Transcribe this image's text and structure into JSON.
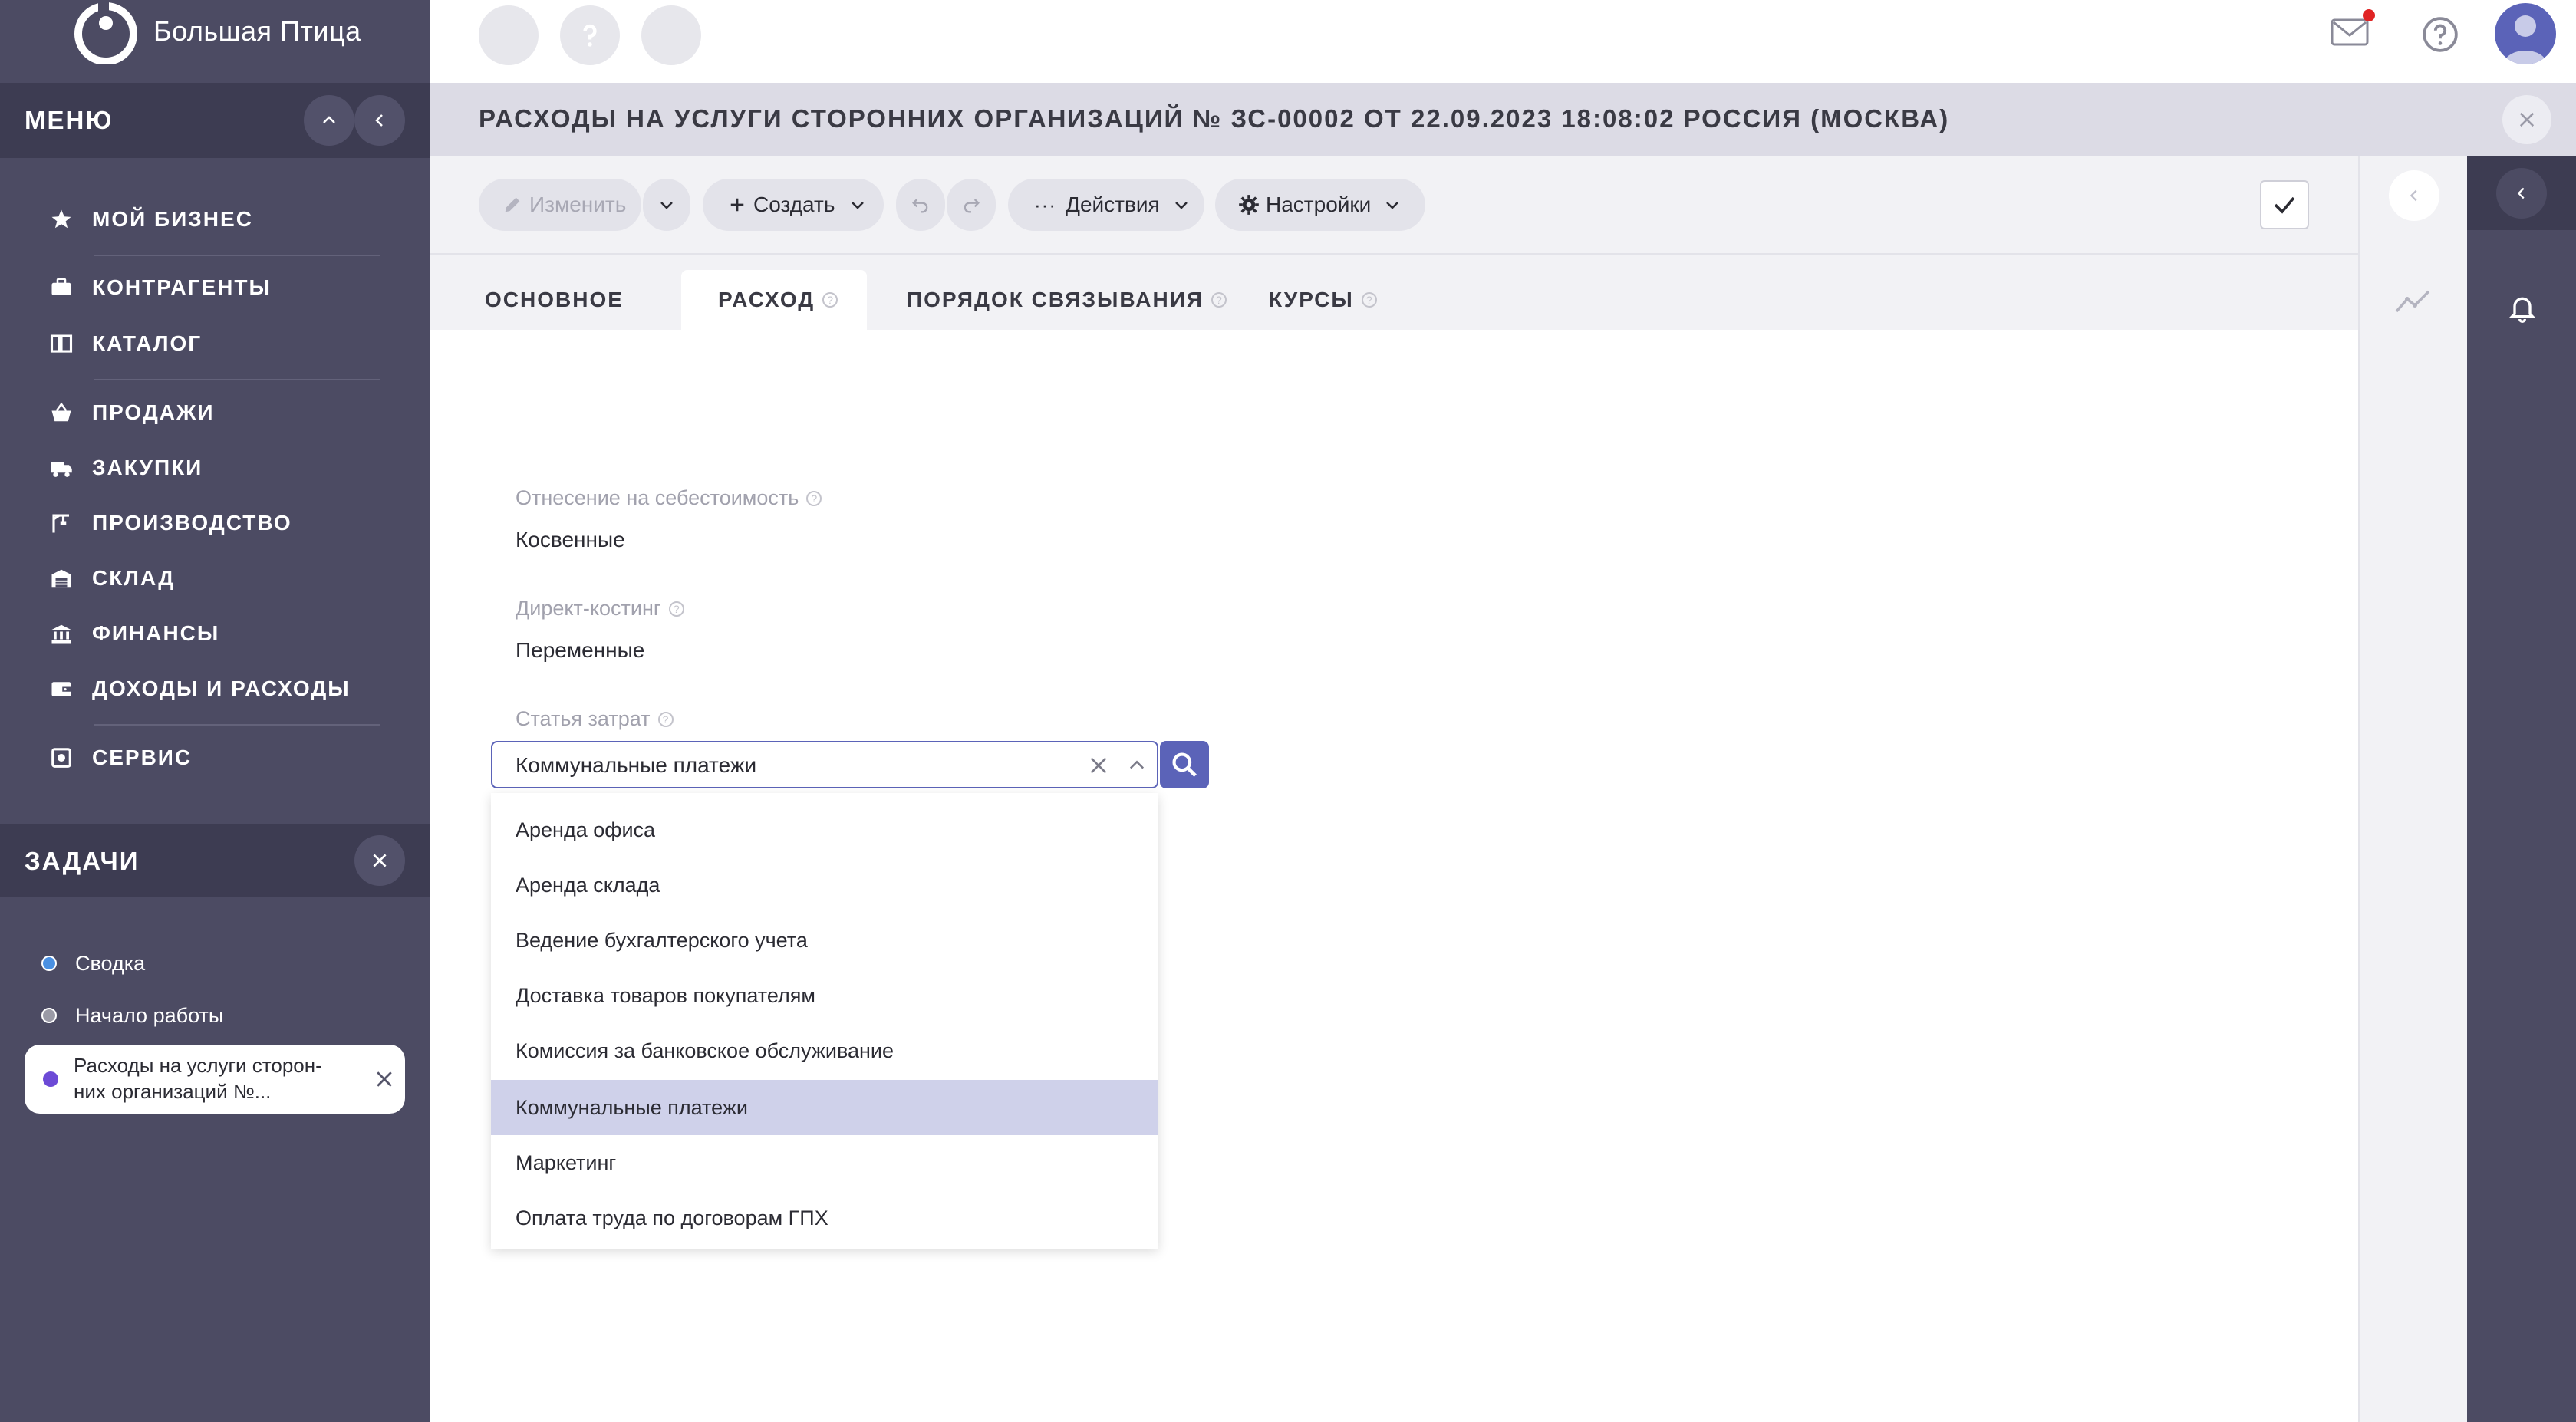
{
  "app": {
    "brand": "Большая Птица"
  },
  "sidebar": {
    "menu_title": "МЕНЮ",
    "items": [
      {
        "label": "МОЙ БИЗНЕС",
        "icon": "star-icon"
      },
      {
        "label": "КОНТРАГЕНТЫ",
        "icon": "briefcase-icon"
      },
      {
        "label": "КАТАЛОГ",
        "icon": "book-icon"
      },
      {
        "label": "ПРОДАЖИ",
        "icon": "basket-icon"
      },
      {
        "label": "ЗАКУПКИ",
        "icon": "truck-icon"
      },
      {
        "label": "ПРОИЗВОДСТВО",
        "icon": "crane-icon"
      },
      {
        "label": "СКЛАД",
        "icon": "warehouse-icon"
      },
      {
        "label": "ФИНАНСЫ",
        "icon": "bank-icon"
      },
      {
        "label": "ДОХОДЫ И РАСХОДЫ",
        "icon": "wallet-icon"
      },
      {
        "label": "СЕРВИС",
        "icon": "service-icon"
      }
    ]
  },
  "tasks": {
    "title": "ЗАДАЧИ",
    "items": [
      {
        "label": "Сводка",
        "dot_color": "#4a90e2"
      },
      {
        "label": "Начало работы",
        "dot_color": "#9a9aa6"
      }
    ],
    "active": {
      "label": "Расходы на услуги сторон-них организаций №...",
      "dot_color": "#6c4ad6"
    }
  },
  "header": {
    "doc_title": "РАСХОДЫ НА УСЛУГИ СТОРОННИХ ОРГАНИЗАЦИЙ № ЗС-00002 ОТ 22.09.2023 18:08:02 РОССИЯ (МОСКВА)",
    "notification_color": "#e02424"
  },
  "toolbar": {
    "edit_label": "Изменить",
    "create_label": "Создать",
    "actions_label": "Действия",
    "settings_label": "Настройки"
  },
  "tabs": [
    {
      "label": "ОСНОВНОЕ"
    },
    {
      "label": "РАСХОД"
    },
    {
      "label": "ПОРЯДОК СВЯЗЫВАНИЯ"
    },
    {
      "label": "КУРСЫ"
    }
  ],
  "form": {
    "cost_attr_label": "Отнесение на себестоимость",
    "cost_attr_value": "Косвенные",
    "direct_costing_label": "Директ-костинг",
    "direct_costing_value": "Переменные",
    "expense_item_label": "Статья затрат",
    "expense_item_value": "Коммунальные платежи"
  },
  "dropdown": {
    "options": [
      "Аренда офиса",
      "Аренда склада",
      "Ведение бухгалтерского учета",
      "Доставка товаров покупателям",
      "Комиссия за банковское обслуживание",
      "Коммунальные платежи",
      "Маркетинг",
      "Оплата труда по договорам ГПХ"
    ],
    "selected": "Коммунальные платежи"
  },
  "colors": {
    "sidebar_bg": "#4c4b63",
    "accent": "#5b63b8",
    "selected_row": "#cfd1ea"
  }
}
